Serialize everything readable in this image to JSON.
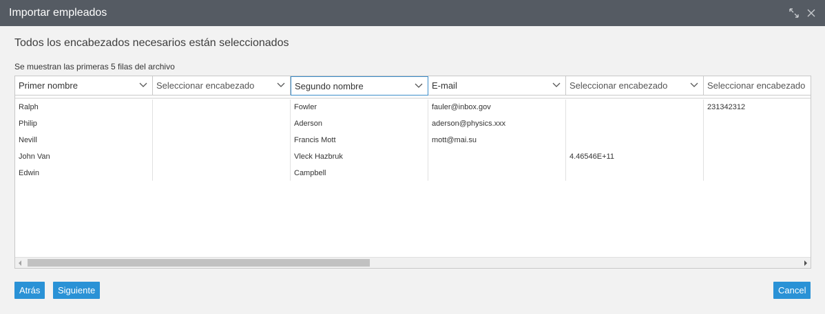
{
  "dialog": {
    "title": "Importar empleados",
    "heading": "Todos los encabezados necesarios están seleccionados",
    "subheading": "Se muestran las primeras 5 filas del archivo"
  },
  "columns": [
    {
      "header": "Primer nombre",
      "cells": [
        "Ralph",
        "Philip",
        "Nevill",
        "John Van",
        "Edwin"
      ]
    },
    {
      "header": "Seleccionar encabezado",
      "cells": [
        "",
        "",
        "",
        "",
        ""
      ]
    },
    {
      "header": "Segundo nombre",
      "cells": [
        "Fowler",
        "Aderson",
        "Francis Mott",
        "Vleck Hazbruk",
        "Campbell"
      ]
    },
    {
      "header": "E-mail",
      "cells": [
        "fauler@inbox.gov",
        "aderson@physics.xxx",
        "mott@mai.su",
        "",
        ""
      ]
    },
    {
      "header": "Seleccionar encabezado",
      "cells": [
        "",
        "",
        "",
        "4.46546E+11",
        ""
      ]
    },
    {
      "header": "Seleccionar encabezado",
      "cells": [
        "231342312",
        "",
        "",
        "",
        ""
      ]
    }
  ],
  "buttons": {
    "back": "Atrás",
    "next": "Siguiente",
    "cancel": "Cancel"
  },
  "icons": {
    "expand": "expand-icon",
    "close": "close-icon",
    "dropdown": "chevron-down-icon",
    "scroll_left": "scroll-left-arrow-icon",
    "scroll_right": "scroll-right-arrow-icon"
  },
  "colors": {
    "titlebar": "#555b63",
    "accent": "#2a92d6",
    "active_header_border": "#3a8cc9"
  },
  "active_column": 2
}
